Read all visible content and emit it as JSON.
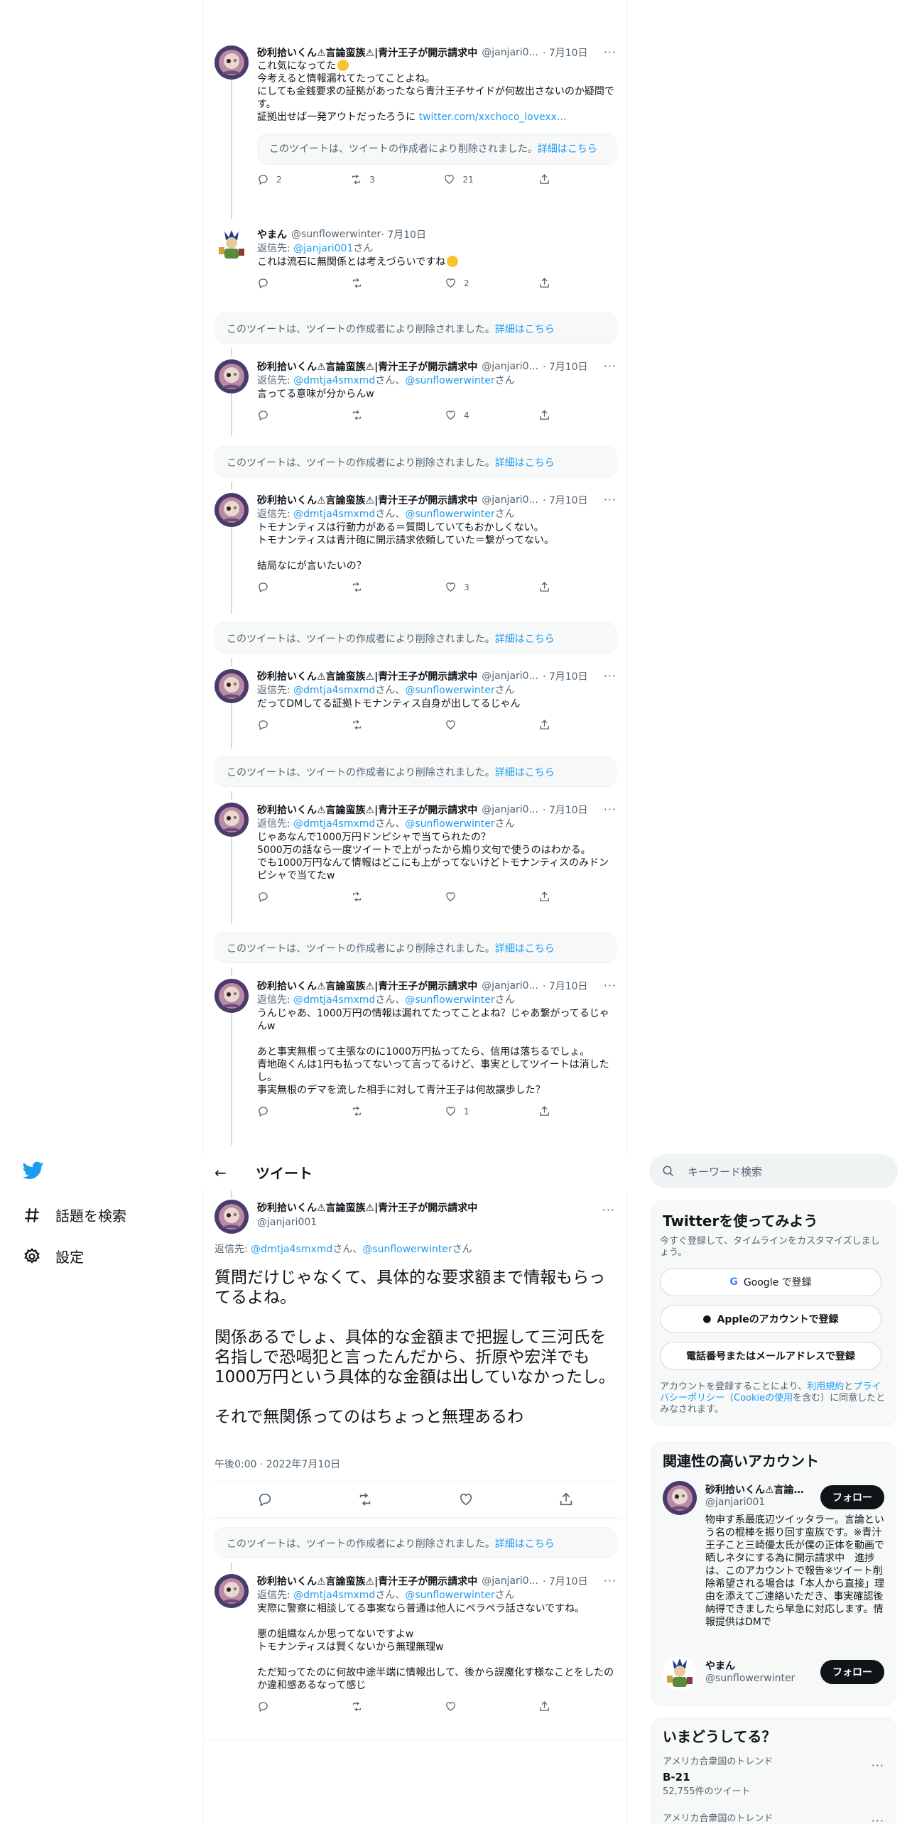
{
  "header": {
    "title": "ツイート"
  },
  "nav": {
    "explore": "話題を検索",
    "settings": "設定"
  },
  "deleted": {
    "text": "このツイートは、ツイートの作成者により削除されました。",
    "link": "詳細はこちら",
    "link2": "詳細はこちら"
  },
  "reply_prefix": "返信先: ",
  "san": "さん",
  "comma": "、",
  "tweets": [
    {
      "name": "砂利拾いくん⚠言論蛮族⚠|青汁王子が開示請求中",
      "handle": "@janjari0...",
      "date": "· 7月10日",
      "text": "これ気になってた",
      "text2": "今考えると情報漏れてたってことよね。\nにしても金銭要求の証拠があったなら青汁王子サイドが何故出さないのか疑問です。\n証拠出せば一発アウトだったろうに ",
      "link": "twitter.com/xxchoco_lovexx...",
      "quote": "このツイートは、ツイートの作成者により削除されました。",
      "quote_link": "詳細はこちら",
      "replies": "2",
      "retweets": "3",
      "likes": "21"
    },
    {
      "name": "やまん",
      "handle": "@sunflowerwinter",
      "date": "· 7月10日",
      "reply_to": "@janjari001",
      "text": "これは流石に無関係とは考えづらいですね",
      "replies": "",
      "retweets": "",
      "likes": "2"
    },
    {
      "name": "砂利拾いくん⚠言論蛮族⚠|青汁王子が開示請求中",
      "handle": "@janjari0...",
      "date": "· 7月10日",
      "reply_to1": "@dmtja4smxmd",
      "reply_to2": "@sunflowerwinter",
      "text": "言ってる意味が分からんw",
      "likes": "4"
    },
    {
      "name": "砂利拾いくん⚠言論蛮族⚠|青汁王子が開示請求中",
      "handle": "@janjari0...",
      "date": "· 7月10日",
      "reply_to1": "@dmtja4smxmd",
      "reply_to2": "@sunflowerwinter",
      "text": "トモナンティスは行動力がある＝質問していてもおかしくない。\nトモナンティスは青汁砲に開示請求依頼していた＝繋がってない。\n\n結局なにが言いたいの？",
      "likes": "3"
    },
    {
      "name": "砂利拾いくん⚠言論蛮族⚠|青汁王子が開示請求中",
      "handle": "@janjari0...",
      "date": "· 7月10日",
      "reply_to1": "@dmtja4smxmd",
      "reply_to2": "@sunflowerwinter",
      "text": "だってDMしてる証拠トモナンティス自身が出してるじゃん",
      "likes": ""
    },
    {
      "name": "砂利拾いくん⚠言論蛮族⚠|青汁王子が開示請求中",
      "handle": "@janjari0...",
      "date": "· 7月10日",
      "reply_to1": "@dmtja4smxmd",
      "reply_to2": "@sunflowerwinter",
      "text": "じゃあなんで1000万円ドンピシャで当てられたの？\n5000万の話なら一度ツイートで上がったから煽り文句で使うのはわかる。\nでも1000万円なんて情報はどこにも上がってないけどトモナンティスのみドンピシャで当てたw",
      "likes": ""
    },
    {
      "name": "砂利拾いくん⚠言論蛮族⚠|青汁王子が開示請求中",
      "handle": "@janjari0...",
      "date": "· 7月10日",
      "reply_to1": "@dmtja4smxmd",
      "reply_to2": "@sunflowerwinter",
      "text": "うんじゃあ、1000万円の情報は漏れてたってことよね？じゃあ繋がってるじゃんw\n\nあと事実無根って主張なのに1000万円払ってたら、信用は落ちるでしょ。\n青地砲くんは1円も払ってないって言ってるけど、事実としてツイートは消したし。\n事実無根のデマを流した相手に対して青汁王子は何故譲歩した？",
      "likes": "1"
    }
  ],
  "main": {
    "name": "砂利拾いくん⚠言論蛮族⚠|青汁王子が開示請求中",
    "handle": "@janjari001",
    "reply_to1": "@dmtja4smxmd",
    "reply_to2": "@sunflowerwinter",
    "text": "質問だけじゃなくて、具体的な要求額まで情報もらってるよね。\n\n関係あるでしょ、具体的な金額まで把握して三河氏を名指しで恐喝犯と言ったんだから、折原や宏洋でも1000万円という具体的な金額は出していなかったし。\n\nそれで無関係ってのはちょっと無理あるわ",
    "time": "午後0:00 · 2022年7月10日"
  },
  "last": {
    "name": "砂利拾いくん⚠言論蛮族⚠|青汁王子が開示請求中",
    "handle": "@janjari0...",
    "date": "· 7月10日",
    "reply_to1": "@dmtja4smxmd",
    "reply_to2": "@sunflowerwinter",
    "text": "実際に警察に相談してる事案なら普通は他人にペラペラ話さないですね。\n\n悪の組織なんか思ってないですよw\nトモナンティスは賢くないから無理無理w\n\nただ知ってたのに何故中途半端に情報出して、後から誤魔化す様なことをしたのか違和感あるなって感じ"
  },
  "search": {
    "placeholder": "キーワード検索"
  },
  "signup": {
    "title": "Twitterを使ってみよう",
    "desc": "今すぐ登録して、タイムラインをカスタマイズしましょう。",
    "google": "Google で登録",
    "apple": "Appleのアカウントで登録",
    "phone": "電話番号またはメールアドレスで登録",
    "legal1": "アカウントを登録することにより、",
    "terms": "利用規約",
    "and": "と",
    "privacy": "プライバシーポリシー",
    "cookie": "（Cookieの使用",
    "legal2": "を含む）に同意したとみなされます。"
  },
  "related": {
    "title": "関連性の高いアカウント",
    "follow": "フォロー",
    "acc1_name": "砂利拾いくん⚠言論蛮族⚠|青汁王子が開示請求中",
    "acc1_handle": "@janjari001",
    "acc1_bio": "物申す系最底辺ツイッタラー。言論という名の棍棒を振り回す蛮族です。※青汁王子こと三崎優太氏が僕の正体を動画で晒しネタにする為に開示請求中　進捗は、このアカウントで報告※ツイート削除希望される場合は「本人から直接」理由を添えてご連絡いただき、事実確認後納得できましたら早急に対応します。情報提供はDMで",
    "acc2_name": "やまん",
    "acc2_handle": "@sunflowerwinter"
  },
  "trends": {
    "title": "いまどうしてる？",
    "t1_cat": "アメリカ合衆国のトレンド",
    "t1_name": "B-21",
    "t1_count": "52,755件のツイート",
    "t2_cat": "アメリカ合衆国のトレンド"
  },
  "colors": {
    "link": "#1d9bf0",
    "text": "#0f1419",
    "muted": "#536471"
  }
}
